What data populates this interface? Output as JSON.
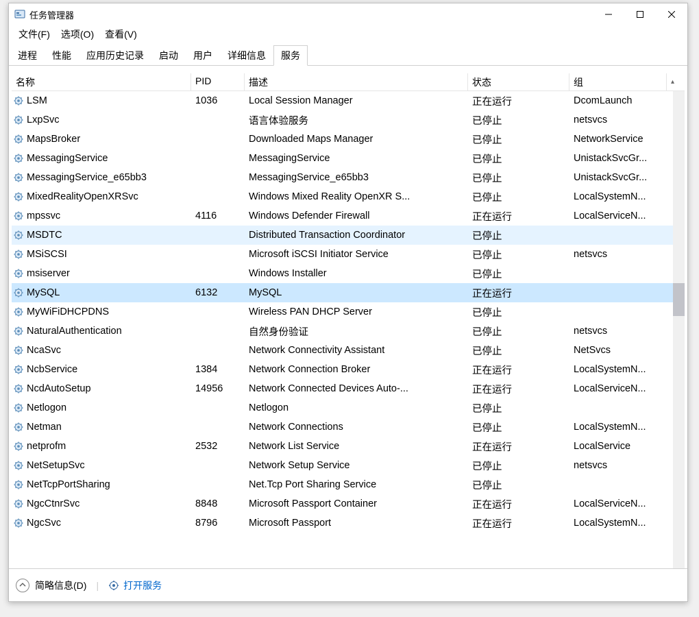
{
  "window": {
    "title": "任务管理器"
  },
  "menu": {
    "file": "文件(F)",
    "options": "选项(O)",
    "view": "查看(V)"
  },
  "tabs": [
    "进程",
    "性能",
    "应用历史记录",
    "启动",
    "用户",
    "详细信息",
    "服务"
  ],
  "active_tab": 6,
  "columns": {
    "name": "名称",
    "pid": "PID",
    "desc": "描述",
    "status": "状态",
    "group": "组"
  },
  "status": {
    "running": "正在运行",
    "stopped": "已停止"
  },
  "footer": {
    "less_details": "简略信息(D)",
    "open_services": "打开服务"
  },
  "services": [
    {
      "name": "LSM",
      "pid": "1036",
      "desc": "Local Session Manager",
      "status": "正在运行",
      "group": "DcomLaunch"
    },
    {
      "name": "LxpSvc",
      "pid": "",
      "desc": "语言体验服务",
      "status": "已停止",
      "group": "netsvcs"
    },
    {
      "name": "MapsBroker",
      "pid": "",
      "desc": "Downloaded Maps Manager",
      "status": "已停止",
      "group": "NetworkService"
    },
    {
      "name": "MessagingService",
      "pid": "",
      "desc": "MessagingService",
      "status": "已停止",
      "group": "UnistackSvcGr..."
    },
    {
      "name": "MessagingService_e65bb3",
      "pid": "",
      "desc": "MessagingService_e65bb3",
      "status": "已停止",
      "group": "UnistackSvcGr..."
    },
    {
      "name": "MixedRealityOpenXRSvc",
      "pid": "",
      "desc": "Windows Mixed Reality OpenXR S...",
      "status": "已停止",
      "group": "LocalSystemN..."
    },
    {
      "name": "mpssvc",
      "pid": "4116",
      "desc": "Windows Defender Firewall",
      "status": "正在运行",
      "group": "LocalServiceN..."
    },
    {
      "name": "MSDTC",
      "pid": "",
      "desc": "Distributed Transaction Coordinator",
      "status": "已停止",
      "group": "",
      "hl": "light"
    },
    {
      "name": "MSiSCSI",
      "pid": "",
      "desc": "Microsoft iSCSI Initiator Service",
      "status": "已停止",
      "group": "netsvcs"
    },
    {
      "name": "msiserver",
      "pid": "",
      "desc": "Windows Installer",
      "status": "已停止",
      "group": ""
    },
    {
      "name": "MySQL",
      "pid": "6132",
      "desc": "MySQL",
      "status": "正在运行",
      "group": "",
      "hl": "sel"
    },
    {
      "name": "MyWiFiDHCPDNS",
      "pid": "",
      "desc": "Wireless PAN DHCP Server",
      "status": "已停止",
      "group": ""
    },
    {
      "name": "NaturalAuthentication",
      "pid": "",
      "desc": "自然身份验证",
      "status": "已停止",
      "group": "netsvcs"
    },
    {
      "name": "NcaSvc",
      "pid": "",
      "desc": "Network Connectivity Assistant",
      "status": "已停止",
      "group": "NetSvcs"
    },
    {
      "name": "NcbService",
      "pid": "1384",
      "desc": "Network Connection Broker",
      "status": "正在运行",
      "group": "LocalSystemN..."
    },
    {
      "name": "NcdAutoSetup",
      "pid": "14956",
      "desc": "Network Connected Devices Auto-...",
      "status": "正在运行",
      "group": "LocalServiceN..."
    },
    {
      "name": "Netlogon",
      "pid": "",
      "desc": "Netlogon",
      "status": "已停止",
      "group": ""
    },
    {
      "name": "Netman",
      "pid": "",
      "desc": "Network Connections",
      "status": "已停止",
      "group": "LocalSystemN..."
    },
    {
      "name": "netprofm",
      "pid": "2532",
      "desc": "Network List Service",
      "status": "正在运行",
      "group": "LocalService"
    },
    {
      "name": "NetSetupSvc",
      "pid": "",
      "desc": "Network Setup Service",
      "status": "已停止",
      "group": "netsvcs"
    },
    {
      "name": "NetTcpPortSharing",
      "pid": "",
      "desc": "Net.Tcp Port Sharing Service",
      "status": "已停止",
      "group": ""
    },
    {
      "name": "NgcCtnrSvc",
      "pid": "8848",
      "desc": "Microsoft Passport Container",
      "status": "正在运行",
      "group": "LocalServiceN..."
    },
    {
      "name": "NgcSvc",
      "pid": "8796",
      "desc": "Microsoft Passport",
      "status": "正在运行",
      "group": "LocalSystemN..."
    }
  ]
}
